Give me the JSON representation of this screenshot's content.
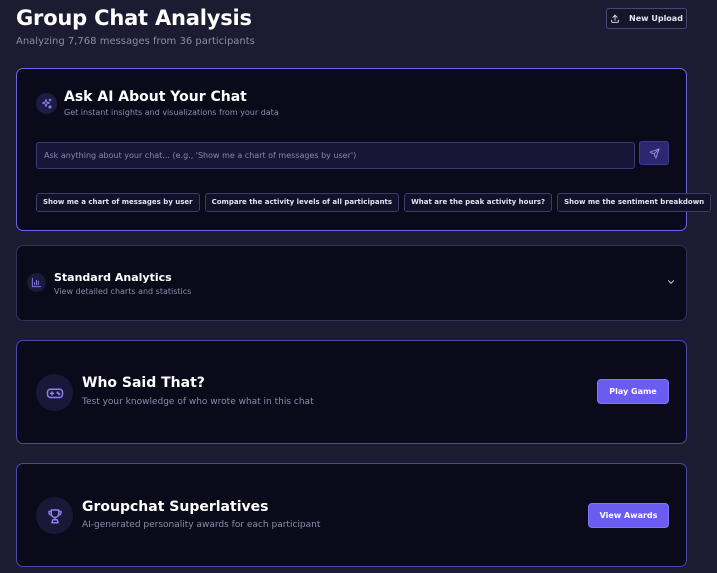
{
  "header": {
    "title": "Group Chat Analysis",
    "subtitle": "Analyzing 7,768 messages from 36 participants",
    "new_upload_label": "New Upload",
    "upload_icon": "upload-icon"
  },
  "ai_panel": {
    "title": "Ask AI About Your Chat",
    "subtitle": "Get instant insights and visualizations from your data",
    "icon": "sparkles-icon",
    "input_placeholder": "Ask anything about your chat... (e.g., 'Show me a chart of messages by user')",
    "input_value": "",
    "send_icon": "send-icon",
    "suggestions": [
      "Show me a chart of messages by user",
      "Compare the activity levels of all participants",
      "What are the peak activity hours?",
      "Show me the sentiment breakdown"
    ]
  },
  "standard_analytics": {
    "title": "Standard Analytics",
    "subtitle": "View detailed charts and statistics",
    "icon": "bar-chart-icon",
    "toggle_icon": "chevron-down-icon"
  },
  "who_said_that": {
    "title": "Who Said That?",
    "subtitle": "Test your knowledge of who wrote what in this chat",
    "button_label": "Play Game",
    "icon": "gamepad-icon"
  },
  "superlatives": {
    "title": "Groupchat Superlatives",
    "subtitle": "AI-generated personality awards for each participant",
    "button_label": "View Awards",
    "icon": "trophy-icon"
  },
  "colors": {
    "background": "#1c1b31",
    "card": "#0b0a1a",
    "accent": "#6a5cf0",
    "accent_border": "#6e63e3",
    "muted_text": "#8d8ba8"
  }
}
